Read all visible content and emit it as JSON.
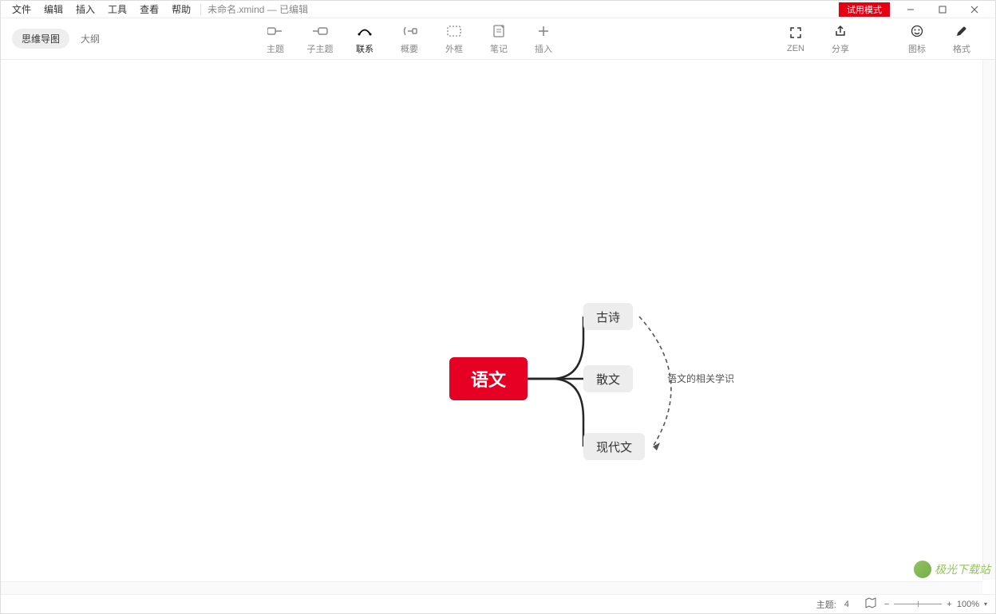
{
  "menu": {
    "file": "文件",
    "edit": "编辑",
    "insert": "插入",
    "tools": "工具",
    "view": "查看",
    "help": "帮助"
  },
  "doc": {
    "title": "未命名.xmind — 已编辑"
  },
  "trial_badge": "试用模式",
  "view_switch": {
    "mindmap": "思维导图",
    "outline": "大纲"
  },
  "tools": {
    "topic": "主题",
    "subtopic": "子主题",
    "relationship": "联系",
    "summary": "概要",
    "boundary": "外框",
    "note": "笔记",
    "insert": "插入",
    "zen": "ZEN",
    "share": "分享",
    "icons": "图标",
    "format": "格式"
  },
  "mindmap": {
    "central": "语文",
    "children": [
      "古诗",
      "散文",
      "现代文"
    ],
    "relationship_label": "语文的相关学识"
  },
  "status": {
    "topic_label": "主题:",
    "topic_count": "4",
    "zoom": "100%"
  },
  "watermark": "极光下载站"
}
